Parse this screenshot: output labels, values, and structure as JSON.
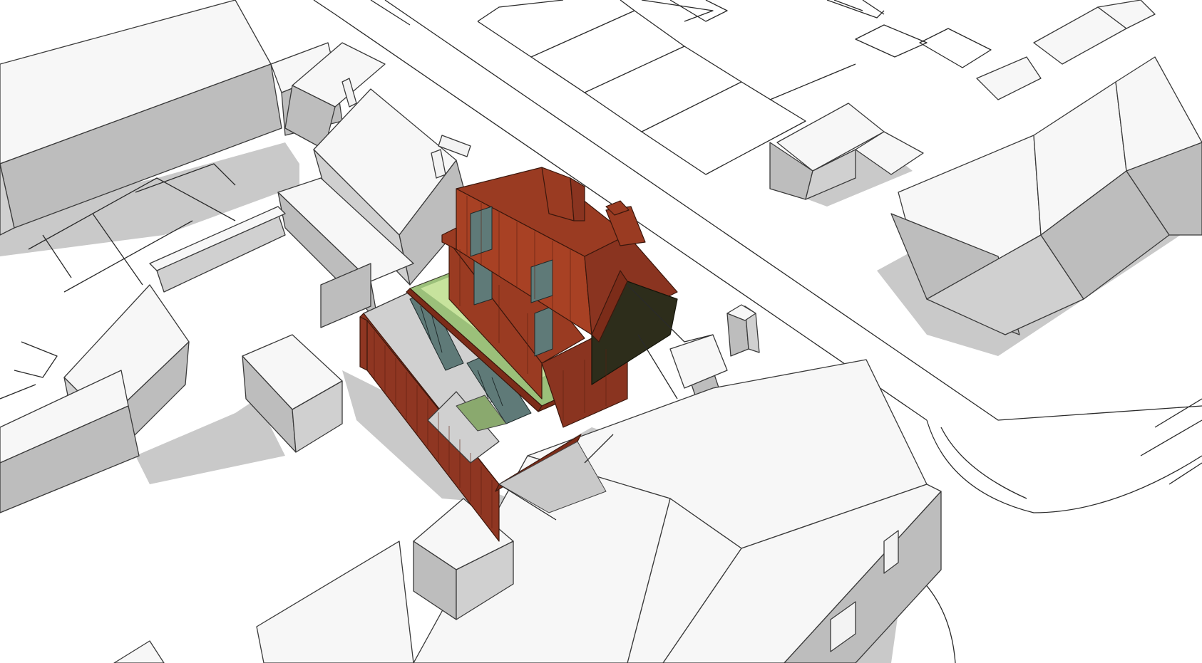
{
  "scene": {
    "subject": "proposed-house-axonometric",
    "colors": {
      "background": "#ffffff",
      "context_wall_light": "#f3f3f3",
      "context_wall_shade": "#bdbdbd",
      "shadow": "#c9c9c9",
      "cladding_red": "#9a3b22",
      "cladding_red_dark": "#7a2a17",
      "glazing": "#5f7a78",
      "green_roof": "#9bc07a",
      "green_roof_light": "#c7e39d",
      "gable_dark": "#2d2d1b",
      "line": "#2a2a2a"
    }
  }
}
